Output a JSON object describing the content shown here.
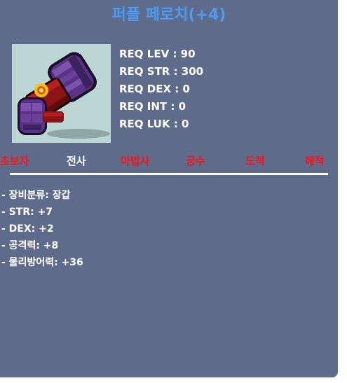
{
  "item": {
    "name": "퍼플 페로치(+4)",
    "icon": "purple-glove-icon"
  },
  "requirements": [
    "REQ LEV : 90",
    "REQ STR : 300",
    "REQ DEX : 0",
    "REQ INT : 0",
    "REQ LUK : 0"
  ],
  "jobs": [
    {
      "label": "초보자",
      "eligible": false
    },
    {
      "label": "전사",
      "eligible": true
    },
    {
      "label": "마법사",
      "eligible": false
    },
    {
      "label": "궁수",
      "eligible": false
    },
    {
      "label": "도적",
      "eligible": false
    },
    {
      "label": "해적",
      "eligible": false
    }
  ],
  "stats": [
    "- 장비분류: 장갑",
    "- STR: +7",
    "- DEX: +2",
    "- 공격력: +8",
    "- 물리방어력: +36"
  ],
  "colors": {
    "panel": "#5e6b8b",
    "title": "#4d9bf2",
    "ineligible_job": "#ff1010",
    "eligible_job": "#ffffff"
  }
}
